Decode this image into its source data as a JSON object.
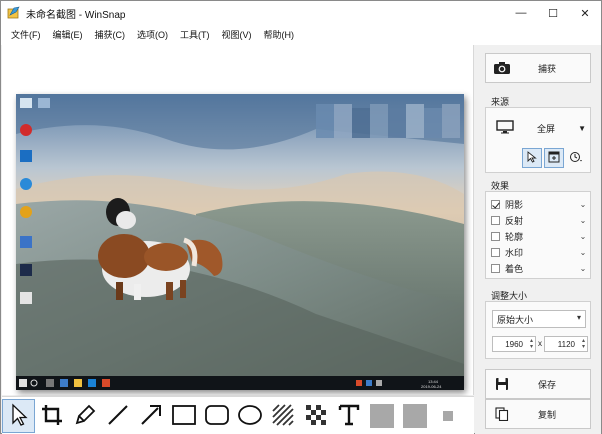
{
  "window": {
    "title": "未命名截图 - WinSnap"
  },
  "titlebar": {
    "minimize": "—",
    "maximize": "☐",
    "close": "✕"
  },
  "menu": [
    "文件(F)",
    "编辑(E)",
    "捕获(C)",
    "选项(O)",
    "工具(T)",
    "视图(V)",
    "帮助(H)"
  ],
  "panel": {
    "capture_label": "捕获",
    "source": {
      "title": "来源",
      "mode": "全屏"
    },
    "effects": {
      "title": "效果",
      "items": [
        {
          "label": "阴影",
          "checked": true
        },
        {
          "label": "反射",
          "checked": false
        },
        {
          "label": "轮廓",
          "checked": false
        },
        {
          "label": "水印",
          "checked": false
        },
        {
          "label": "着色",
          "checked": false
        }
      ]
    },
    "resize": {
      "title": "调整大小",
      "mode": "原始大小",
      "width": "1960",
      "x_sep": "x",
      "height": "1120"
    },
    "save_label": "保存",
    "copy_label": "复制"
  },
  "taskbar": {
    "time": "13:44",
    "date": "2019-06-24"
  },
  "colors": {
    "accent": "#1e5fb0",
    "active_bg": "#dce9f6",
    "fill_gray": "#a8a8a8"
  },
  "tools": [
    "pointer-tool",
    "crop-tool",
    "pen-tool",
    "line-tool",
    "arrow-tool",
    "rectangle-tool",
    "rounded-rect-tool",
    "ellipse-tool",
    "hatch-tool",
    "pixelate-tool",
    "text-tool",
    "fill-color",
    "outline-color",
    "line-width"
  ]
}
